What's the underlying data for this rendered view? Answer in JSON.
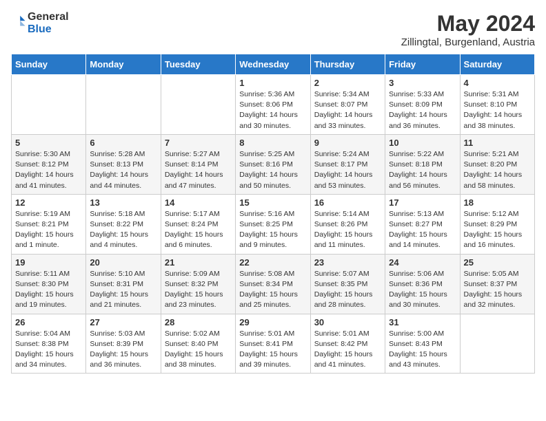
{
  "header": {
    "logo_general": "General",
    "logo_blue": "Blue",
    "title": "May 2024",
    "subtitle": "Zillingtal, Burgenland, Austria"
  },
  "calendar": {
    "days_of_week": [
      "Sunday",
      "Monday",
      "Tuesday",
      "Wednesday",
      "Thursday",
      "Friday",
      "Saturday"
    ],
    "weeks": [
      [
        {
          "day": "",
          "info": ""
        },
        {
          "day": "",
          "info": ""
        },
        {
          "day": "",
          "info": ""
        },
        {
          "day": "1",
          "info": "Sunrise: 5:36 AM\nSunset: 8:06 PM\nDaylight: 14 hours\nand 30 minutes."
        },
        {
          "day": "2",
          "info": "Sunrise: 5:34 AM\nSunset: 8:07 PM\nDaylight: 14 hours\nand 33 minutes."
        },
        {
          "day": "3",
          "info": "Sunrise: 5:33 AM\nSunset: 8:09 PM\nDaylight: 14 hours\nand 36 minutes."
        },
        {
          "day": "4",
          "info": "Sunrise: 5:31 AM\nSunset: 8:10 PM\nDaylight: 14 hours\nand 38 minutes."
        }
      ],
      [
        {
          "day": "5",
          "info": "Sunrise: 5:30 AM\nSunset: 8:12 PM\nDaylight: 14 hours\nand 41 minutes."
        },
        {
          "day": "6",
          "info": "Sunrise: 5:28 AM\nSunset: 8:13 PM\nDaylight: 14 hours\nand 44 minutes."
        },
        {
          "day": "7",
          "info": "Sunrise: 5:27 AM\nSunset: 8:14 PM\nDaylight: 14 hours\nand 47 minutes."
        },
        {
          "day": "8",
          "info": "Sunrise: 5:25 AM\nSunset: 8:16 PM\nDaylight: 14 hours\nand 50 minutes."
        },
        {
          "day": "9",
          "info": "Sunrise: 5:24 AM\nSunset: 8:17 PM\nDaylight: 14 hours\nand 53 minutes."
        },
        {
          "day": "10",
          "info": "Sunrise: 5:22 AM\nSunset: 8:18 PM\nDaylight: 14 hours\nand 56 minutes."
        },
        {
          "day": "11",
          "info": "Sunrise: 5:21 AM\nSunset: 8:20 PM\nDaylight: 14 hours\nand 58 minutes."
        }
      ],
      [
        {
          "day": "12",
          "info": "Sunrise: 5:19 AM\nSunset: 8:21 PM\nDaylight: 15 hours\nand 1 minute."
        },
        {
          "day": "13",
          "info": "Sunrise: 5:18 AM\nSunset: 8:22 PM\nDaylight: 15 hours\nand 4 minutes."
        },
        {
          "day": "14",
          "info": "Sunrise: 5:17 AM\nSunset: 8:24 PM\nDaylight: 15 hours\nand 6 minutes."
        },
        {
          "day": "15",
          "info": "Sunrise: 5:16 AM\nSunset: 8:25 PM\nDaylight: 15 hours\nand 9 minutes."
        },
        {
          "day": "16",
          "info": "Sunrise: 5:14 AM\nSunset: 8:26 PM\nDaylight: 15 hours\nand 11 minutes."
        },
        {
          "day": "17",
          "info": "Sunrise: 5:13 AM\nSunset: 8:27 PM\nDaylight: 15 hours\nand 14 minutes."
        },
        {
          "day": "18",
          "info": "Sunrise: 5:12 AM\nSunset: 8:29 PM\nDaylight: 15 hours\nand 16 minutes."
        }
      ],
      [
        {
          "day": "19",
          "info": "Sunrise: 5:11 AM\nSunset: 8:30 PM\nDaylight: 15 hours\nand 19 minutes."
        },
        {
          "day": "20",
          "info": "Sunrise: 5:10 AM\nSunset: 8:31 PM\nDaylight: 15 hours\nand 21 minutes."
        },
        {
          "day": "21",
          "info": "Sunrise: 5:09 AM\nSunset: 8:32 PM\nDaylight: 15 hours\nand 23 minutes."
        },
        {
          "day": "22",
          "info": "Sunrise: 5:08 AM\nSunset: 8:34 PM\nDaylight: 15 hours\nand 25 minutes."
        },
        {
          "day": "23",
          "info": "Sunrise: 5:07 AM\nSunset: 8:35 PM\nDaylight: 15 hours\nand 28 minutes."
        },
        {
          "day": "24",
          "info": "Sunrise: 5:06 AM\nSunset: 8:36 PM\nDaylight: 15 hours\nand 30 minutes."
        },
        {
          "day": "25",
          "info": "Sunrise: 5:05 AM\nSunset: 8:37 PM\nDaylight: 15 hours\nand 32 minutes."
        }
      ],
      [
        {
          "day": "26",
          "info": "Sunrise: 5:04 AM\nSunset: 8:38 PM\nDaylight: 15 hours\nand 34 minutes."
        },
        {
          "day": "27",
          "info": "Sunrise: 5:03 AM\nSunset: 8:39 PM\nDaylight: 15 hours\nand 36 minutes."
        },
        {
          "day": "28",
          "info": "Sunrise: 5:02 AM\nSunset: 8:40 PM\nDaylight: 15 hours\nand 38 minutes."
        },
        {
          "day": "29",
          "info": "Sunrise: 5:01 AM\nSunset: 8:41 PM\nDaylight: 15 hours\nand 39 minutes."
        },
        {
          "day": "30",
          "info": "Sunrise: 5:01 AM\nSunset: 8:42 PM\nDaylight: 15 hours\nand 41 minutes."
        },
        {
          "day": "31",
          "info": "Sunrise: 5:00 AM\nSunset: 8:43 PM\nDaylight: 15 hours\nand 43 minutes."
        },
        {
          "day": "",
          "info": ""
        }
      ]
    ]
  }
}
